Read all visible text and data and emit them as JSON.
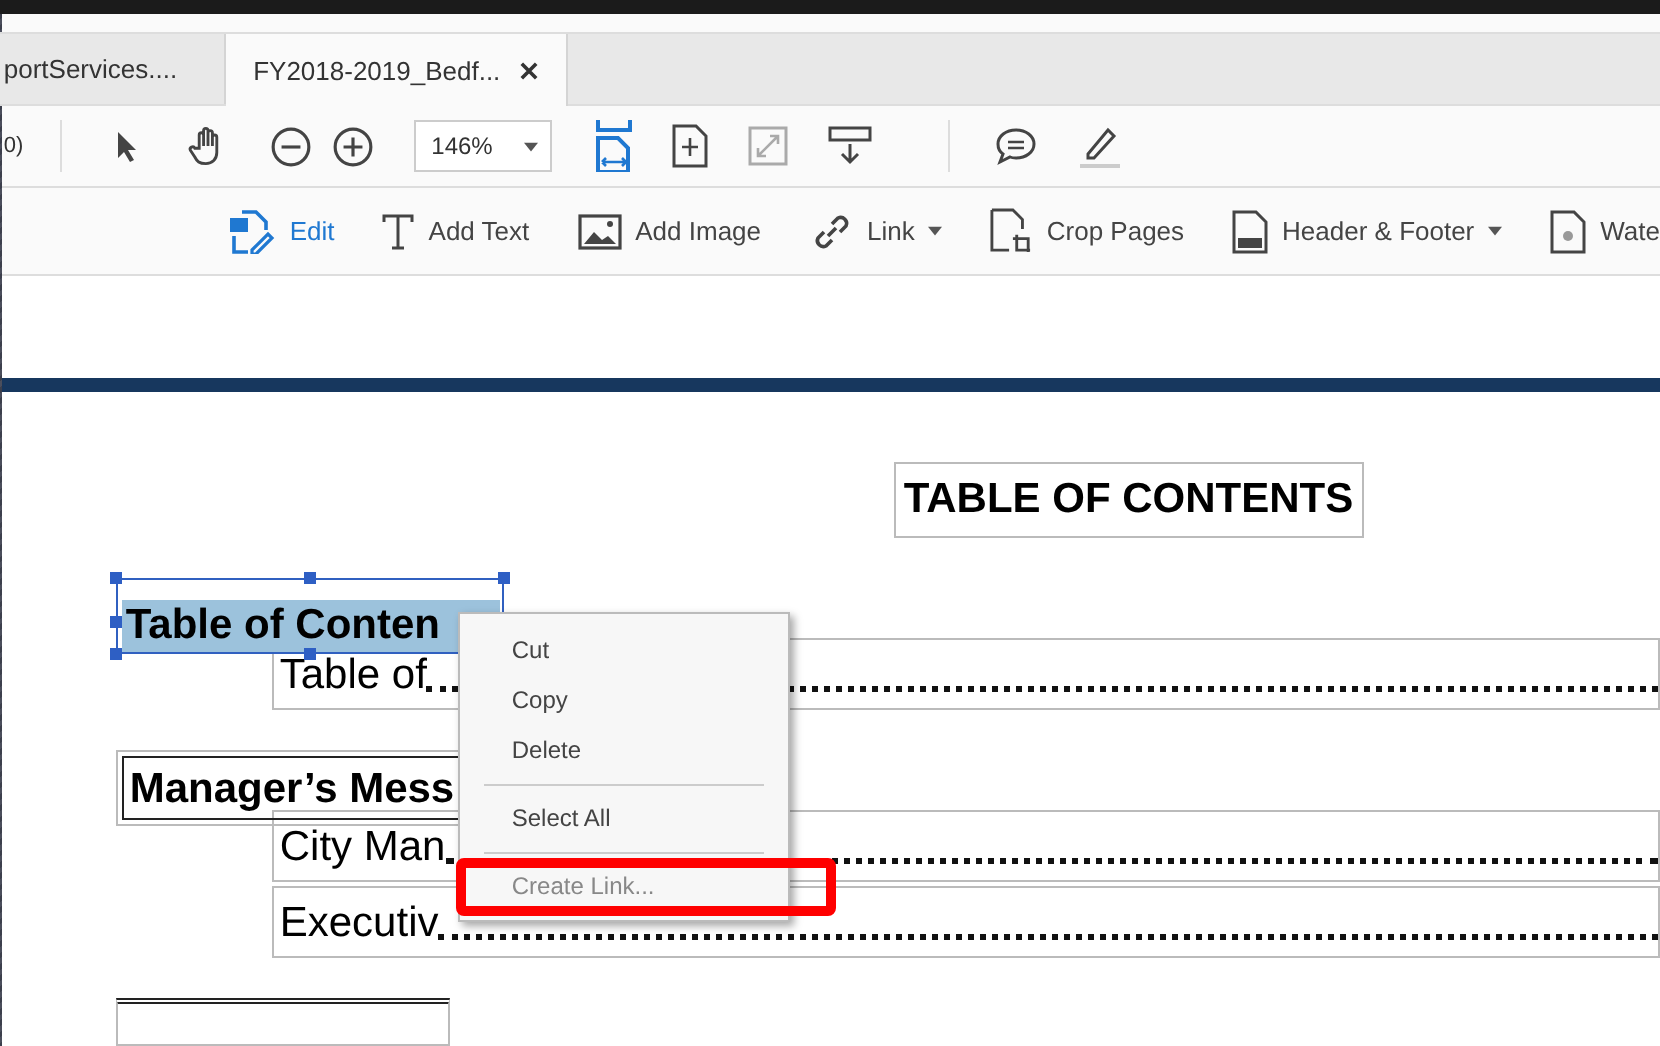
{
  "tabs": [
    {
      "label": "portServices....",
      "selected": false,
      "closable": false
    },
    {
      "label": "FY2018-2019_Bedf...",
      "selected": true,
      "closable": true
    }
  ],
  "toolbar": {
    "page_indicator": "0)",
    "zoom": "146%"
  },
  "edit_tools": [
    {
      "label": "Edit",
      "selected": true,
      "dropdown": false
    },
    {
      "label": "Add Text",
      "selected": false,
      "dropdown": false
    },
    {
      "label": "Add Image",
      "selected": false,
      "dropdown": false
    },
    {
      "label": "Link",
      "selected": false,
      "dropdown": true
    },
    {
      "label": "Crop Pages",
      "selected": false,
      "dropdown": false
    },
    {
      "label": "Header & Footer",
      "selected": false,
      "dropdown": true
    },
    {
      "label": "Wate",
      "selected": false,
      "dropdown": false
    }
  ],
  "document": {
    "title": "TABLE OF CONTENTS",
    "sections": [
      {
        "heading": "Table of Conten",
        "selected": true,
        "entries": [
          "Table of"
        ]
      },
      {
        "heading": "Manager’s Mess",
        "selected": false,
        "entries": [
          "City Man",
          "Executiv"
        ]
      }
    ]
  },
  "context_menu": [
    {
      "kind": "item",
      "label": "Cut",
      "disabled": false,
      "highlighted": false
    },
    {
      "kind": "item",
      "label": "Copy",
      "disabled": false,
      "highlighted": false
    },
    {
      "kind": "item",
      "label": "Delete",
      "disabled": false,
      "highlighted": false
    },
    {
      "kind": "separator"
    },
    {
      "kind": "item",
      "label": "Select All",
      "disabled": false,
      "highlighted": false
    },
    {
      "kind": "separator"
    },
    {
      "kind": "item",
      "label": "Create Link...",
      "disabled": true,
      "highlighted": true
    }
  ]
}
